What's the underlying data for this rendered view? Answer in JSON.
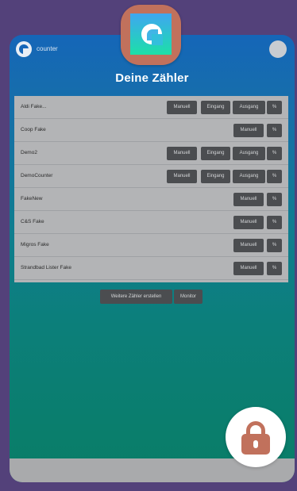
{
  "app": {
    "brand": "counter",
    "title": "Deine Zähler"
  },
  "colors": {
    "background": "#53417a",
    "accent": "#c1715c",
    "button": "#4b4d50",
    "table": "#b3b4b6"
  },
  "icons": {
    "app_icon": "counter-logo-icon",
    "lock": "lock-icon",
    "profile": "avatar-icon"
  },
  "counters": [
    {
      "name": "Aldi Fake...",
      "buttons": {
        "manual": "Manuell",
        "in": "Eingang",
        "out": "Ausgang",
        "pct": "%"
      }
    },
    {
      "name": "Coop Fake",
      "buttons": {
        "manual": "Manuell",
        "pct": "%"
      }
    },
    {
      "name": "Demo2",
      "buttons": {
        "manual": "Manuell",
        "in": "Eingang",
        "out": "Ausgang",
        "pct": "%"
      }
    },
    {
      "name": "DemoCounter",
      "buttons": {
        "manual": "Manuell",
        "in": "Eingang",
        "out": "Ausgang",
        "pct": "%"
      }
    },
    {
      "name": "FakeNew",
      "buttons": {
        "manual": "Manuell",
        "pct": "%"
      }
    },
    {
      "name": "C&S Fake",
      "buttons": {
        "manual": "Manuell",
        "pct": "%"
      }
    },
    {
      "name": "Migros Fake",
      "buttons": {
        "manual": "Manuell",
        "pct": "%"
      }
    },
    {
      "name": "Strandbad Lister Fake",
      "buttons": {
        "manual": "Manuell",
        "pct": "%"
      }
    }
  ],
  "actions": {
    "create_more": "Weitere Zähler erstellen",
    "monitor": "Monitor"
  }
}
